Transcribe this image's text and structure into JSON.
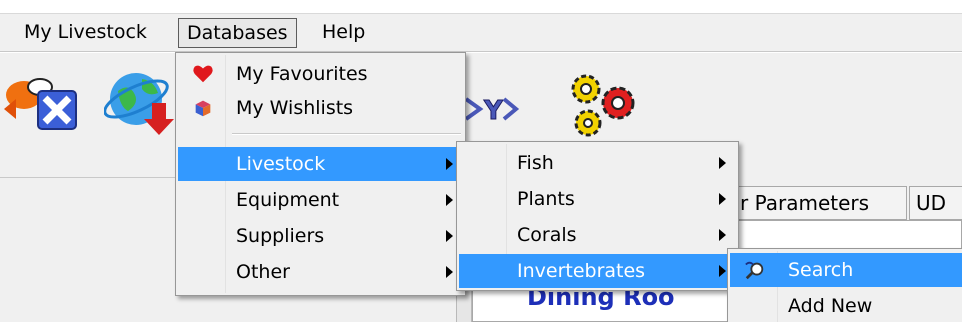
{
  "menubar": {
    "items": [
      {
        "label": "My Livestock"
      },
      {
        "label": "Databases"
      },
      {
        "label": "Help"
      }
    ]
  },
  "databases_menu": {
    "items": [
      {
        "label": "My Favourites",
        "icon": "heart-icon"
      },
      {
        "label": "My Wishlists",
        "icon": "gift-icon"
      },
      {
        "label": "Livestock",
        "has_submenu": true,
        "highlighted": true
      },
      {
        "label": "Equipment",
        "has_submenu": true
      },
      {
        "label": "Suppliers",
        "has_submenu": true
      },
      {
        "label": "Other",
        "has_submenu": true
      }
    ]
  },
  "livestock_submenu": {
    "items": [
      {
        "label": "Fish",
        "has_submenu": true
      },
      {
        "label": "Plants",
        "has_submenu": true
      },
      {
        "label": "Corals",
        "has_submenu": true
      },
      {
        "label": "Invertebrates",
        "has_submenu": true,
        "highlighted": true
      }
    ]
  },
  "invertebrates_submenu": {
    "items": [
      {
        "label": "Search",
        "icon": "search-icon",
        "highlighted": true
      },
      {
        "label": "Add New"
      }
    ]
  },
  "tabs": [
    {
      "label": "r Parameters"
    },
    {
      "label": "UD"
    }
  ],
  "content": {
    "title": "Dining Roo"
  },
  "toolbar": {
    "icons": [
      "fish-icon",
      "globe-download-icon",
      "xy-chart-icon",
      "gears-icon"
    ]
  },
  "colors": {
    "highlight": "#3399ff",
    "menu_bg": "#f0f0f0",
    "title_blue": "#1d2fb8"
  }
}
